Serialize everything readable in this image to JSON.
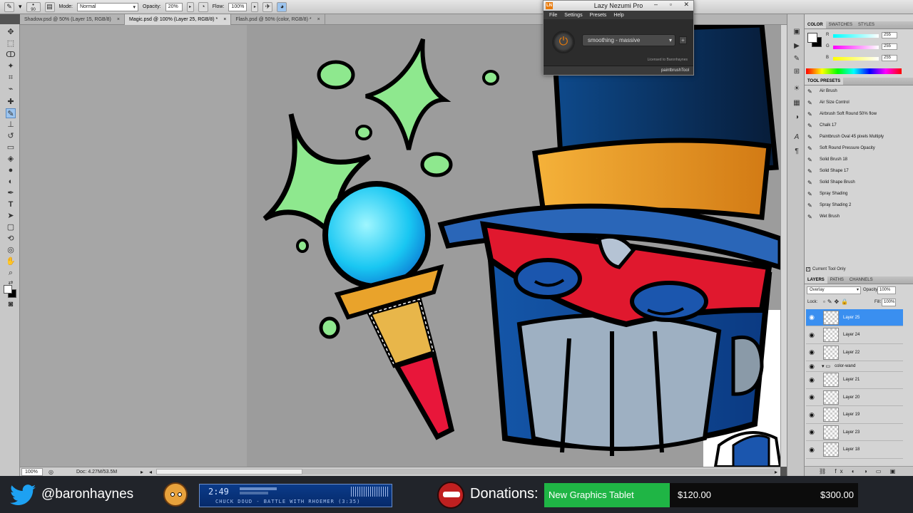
{
  "options_bar": {
    "brush_size": "90",
    "mode_label": "Mode:",
    "mode_value": "Normal",
    "opacity_label": "Opacity:",
    "opacity_value": "20%",
    "flow_label": "Flow:",
    "flow_value": "100%"
  },
  "doc_tabs": [
    {
      "label": "Shadow.psd @ 50% (Layer 15, RGB/8)",
      "close": "×"
    },
    {
      "label": "Magic.psd @ 100% (Layer 25, RGB/8) *",
      "close": "×"
    },
    {
      "label": "Flash.psd @ 50% (color, RGB/8) *",
      "close": "×"
    }
  ],
  "status": {
    "zoom": "100%",
    "doc": "Doc: 4.27M/53.5M"
  },
  "lazy_nezumi": {
    "title": "Lazy Nezumi Pro",
    "logo": "LN",
    "menu": [
      "File",
      "Settings",
      "Presets",
      "Help"
    ],
    "preset": "smoothing - massive",
    "license": "Licensed to Baronhaynes",
    "tool": "paintbrushTool"
  },
  "color_panel": {
    "tabs": [
      "COLOR",
      "SWATCHES",
      "STYLES"
    ],
    "r_label": "R",
    "r": "255",
    "g_label": "G",
    "g": "255",
    "b_label": "B",
    "b": "255"
  },
  "tool_presets": {
    "header": "TOOL PRESETS",
    "items": [
      "Air Brush",
      "Air Size Control",
      "Airbrush Soft Round 50% flow",
      "Chalk 17",
      "Paintbrush Oval 45 pixels Multiply",
      "Soft Round Pressure Opacity",
      "Solid Brush 18",
      "Solid Shape 17",
      "Solid Shape Brush",
      "Spray Shading",
      "Spray Shading 2",
      "Wet Brush"
    ],
    "current_only": "Current Tool Only"
  },
  "layers": {
    "tabs": [
      "LAYERS",
      "PATHS",
      "CHANNELS"
    ],
    "blend": "Overlay",
    "opacity_label": "Opacity:",
    "opacity": "100%",
    "lock_label": "Lock:",
    "fill_label": "Fill:",
    "fill": "100%",
    "items": [
      {
        "name": "Layer 25"
      },
      {
        "name": "Layer 24"
      },
      {
        "name": "Layer 22"
      },
      {
        "name": "color-wand"
      },
      {
        "name": "Layer 21"
      },
      {
        "name": "Layer 20"
      },
      {
        "name": "Layer 19"
      },
      {
        "name": "Layer 23"
      },
      {
        "name": "Layer 18"
      }
    ]
  },
  "stream_bar": {
    "handle": "@baronhaynes",
    "player_time": "2:49",
    "player_track": "CHUCK DOUD - BATTLE WITH RHOEMER (3:35)",
    "donations_label": "Donations:",
    "goal_name": "New Graphics Tablet",
    "current": "$120.00",
    "target": "$300.00",
    "progress_fraction": 0.4,
    "twitter_color": "#1da1f2",
    "goal_color": "#1fb545"
  }
}
